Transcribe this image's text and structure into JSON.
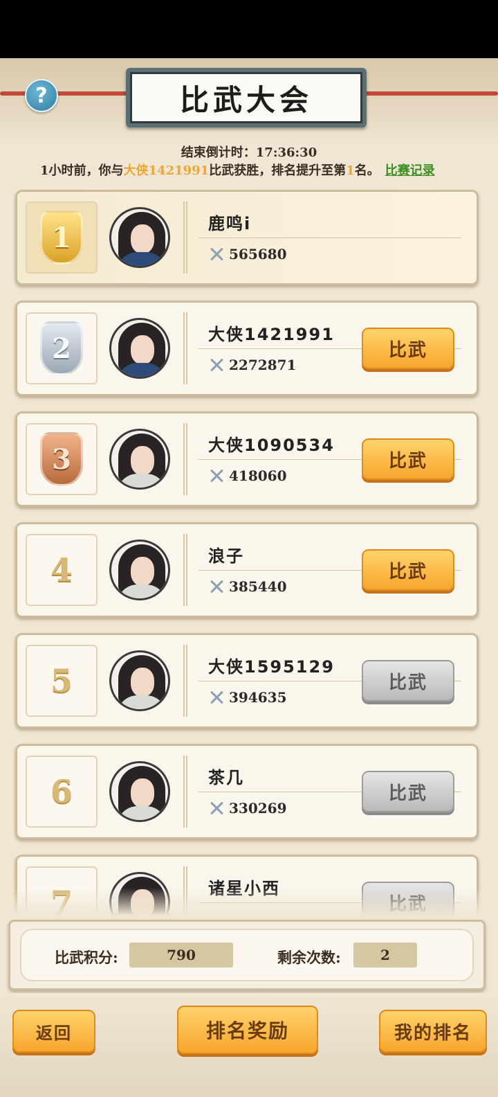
{
  "header": {
    "title": "比武大会",
    "help_glyph": "?"
  },
  "status": {
    "countdown": "结束倒计时：17:36:30",
    "notice_prefix": "1小时前，你与",
    "notice_opponent": "大侠1421991",
    "notice_middle": "比武获胜，排名提升至第",
    "notice_rank": "1",
    "notice_suffix": "名。",
    "record_link": "比赛记录"
  },
  "rankings": [
    {
      "rank": "1",
      "badge": "gold-medal",
      "avatar": "female",
      "name": "鹿鸣i",
      "power": "565680",
      "button": "",
      "button_enabled": false
    },
    {
      "rank": "2",
      "badge": "silver-medal",
      "avatar": "female",
      "name": "大侠1421991",
      "power": "2272871",
      "button": "比武",
      "button_enabled": true
    },
    {
      "rank": "3",
      "badge": "bronze-medal",
      "avatar": "male",
      "name": "大侠1090534",
      "power": "418060",
      "button": "比武",
      "button_enabled": true
    },
    {
      "rank": "4",
      "badge": "number",
      "avatar": "male",
      "name": "浪子",
      "power": "385440",
      "button": "比武",
      "button_enabled": true
    },
    {
      "rank": "5",
      "badge": "number",
      "avatar": "male",
      "name": "大侠1595129",
      "power": "394635",
      "button": "比武",
      "button_enabled": false
    },
    {
      "rank": "6",
      "badge": "number",
      "avatar": "male",
      "name": "茶几",
      "power": "330269",
      "button": "比武",
      "button_enabled": false
    },
    {
      "rank": "7",
      "badge": "number",
      "avatar": "male",
      "name": "诸星小西",
      "power": "",
      "button": "比武",
      "button_enabled": false
    }
  ],
  "score_panel": {
    "points_label": "比武积分:",
    "points_value": "790",
    "remaining_label": "剩余次数:",
    "remaining_value": "2"
  },
  "footer": {
    "back_label": "返回",
    "reward_label": "排名奖励",
    "my_rank_label": "我的排名"
  },
  "colors": {
    "accent_orange": "#f7a62d",
    "highlight_yellow": "#f0a532",
    "link_green": "#3c8f22",
    "background": "#efe6d4"
  }
}
